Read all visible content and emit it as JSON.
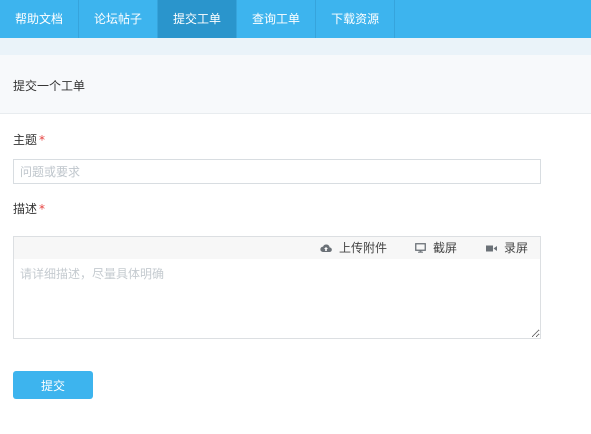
{
  "nav": {
    "items": [
      {
        "label": "帮助文档",
        "active": false
      },
      {
        "label": "论坛帖子",
        "active": false
      },
      {
        "label": "提交工单",
        "active": true
      },
      {
        "label": "查询工单",
        "active": false
      },
      {
        "label": "下载资源",
        "active": false
      }
    ]
  },
  "panel": {
    "title": "提交一个工单"
  },
  "form": {
    "subject": {
      "label": "主题",
      "required_mark": "*",
      "placeholder": "问题或要求",
      "value": ""
    },
    "description": {
      "label": "描述",
      "required_mark": "*",
      "placeholder": "请详细描述，尽量具体明确",
      "value": ""
    },
    "toolbar": {
      "upload_label": "上传附件",
      "upload_icon": "cloud-upload-icon",
      "screenshot_label": "截屏",
      "screenshot_icon": "monitor-icon",
      "record_label": "录屏",
      "record_icon": "video-camera-icon"
    },
    "submit_label": "提交"
  },
  "colors": {
    "accent": "#3db4ee",
    "nav_active": "#2a95cc",
    "required": "#e64340"
  }
}
